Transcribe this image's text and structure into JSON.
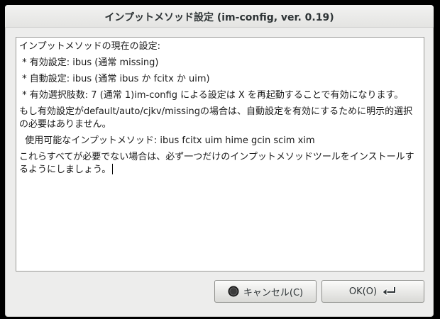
{
  "window": {
    "title": "インプットメソッド設定 (im-config, ver. 0.19)"
  },
  "message": {
    "lines": [
      "インプットメソッドの現在の設定:",
      " * 有効設定: ibus (通常 missing)",
      " * 自動設定: ibus (通常 ibus か fcitx か uim)",
      " * 有効選択肢数: 7 (通常 1)im-config による設定は X を再起動することで有効になります。",
      "もし有効設定がdefault/auto/cjkv/missingの場合は、自動設定を有効にするために明示的選択の必要はありません。",
      "  使用可能なインプットメソッド: ibus fcitx uim hime gcin scim xim",
      "これらすべてが必要でない場合は、必ず一つだけのインプットメソッドツールをインストールするようにしましょう。"
    ]
  },
  "buttons": {
    "cancel_label": "キャンセル(C)",
    "ok_label": "OK(O)"
  },
  "icons": {
    "cancel": "stop-circle-icon",
    "ok": "return-arrow-icon"
  }
}
